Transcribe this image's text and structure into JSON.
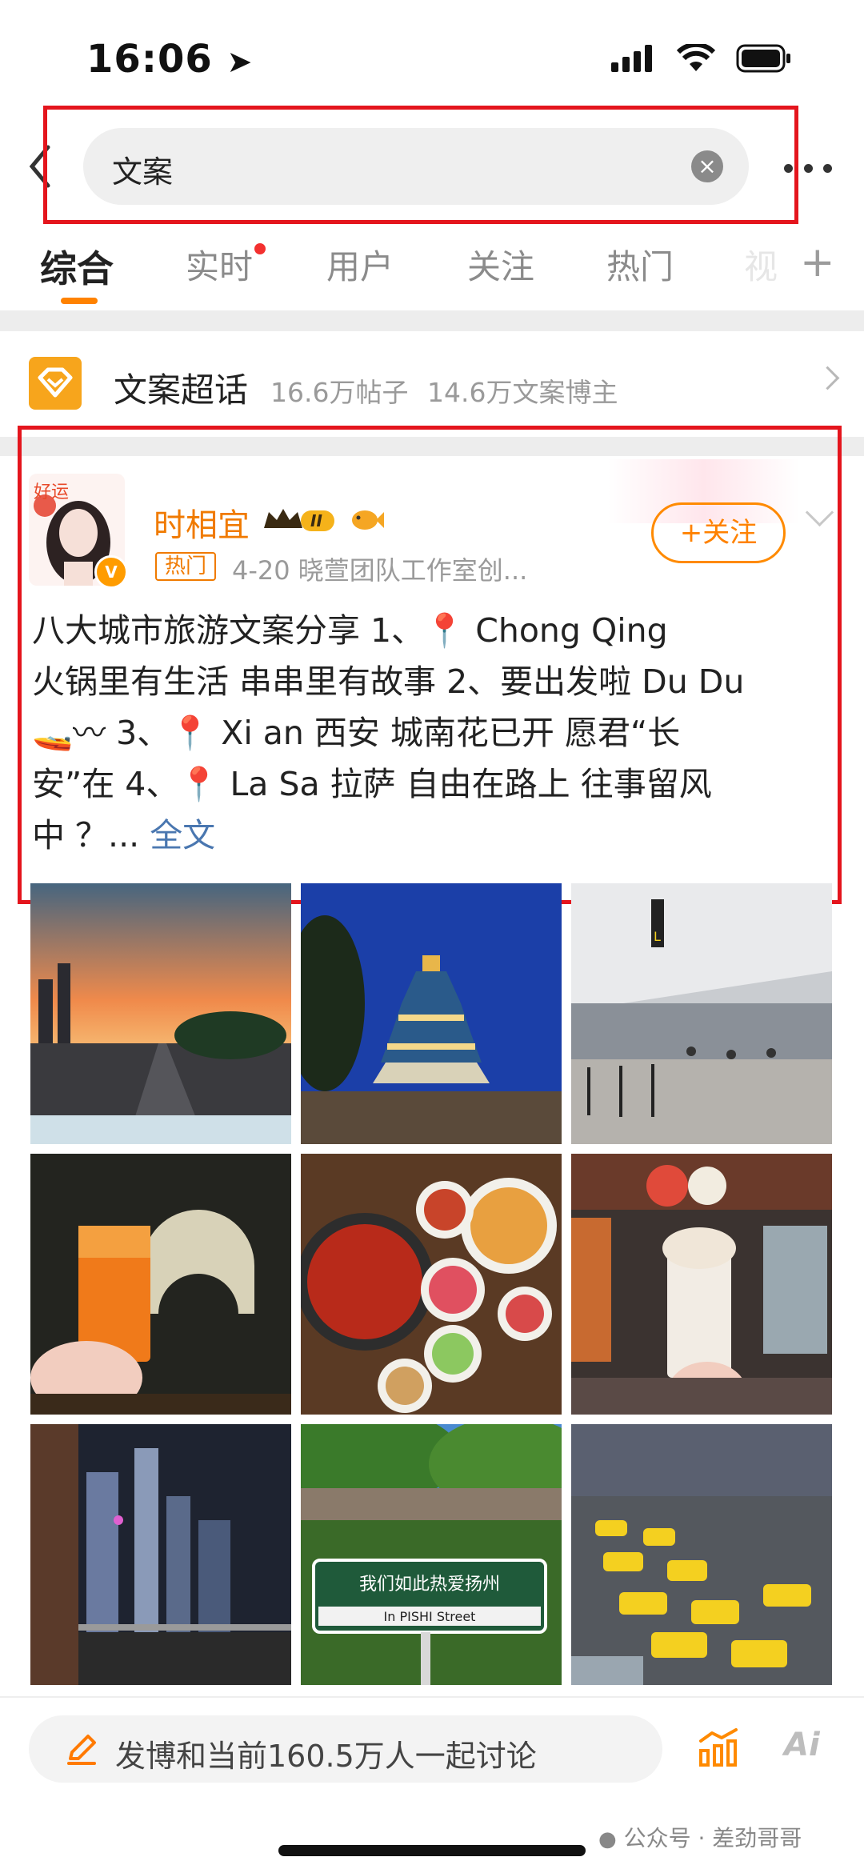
{
  "status_bar": {
    "time": "16:06"
  },
  "search": {
    "query": "文案"
  },
  "tabs": [
    {
      "label": "综合",
      "active": true
    },
    {
      "label": "实时",
      "has_dot": true
    },
    {
      "label": "用户"
    },
    {
      "label": "关注"
    },
    {
      "label": "热门"
    }
  ],
  "super_topic": {
    "name": "文案超话",
    "posts": "16.6万帖子",
    "bloggers": "14.6万文案博主"
  },
  "post": {
    "author": "时相宜",
    "hot_badge": "热门",
    "meta": "4-20  晓萱团队工作室创...",
    "follow_label": "+关注",
    "text_lines": [
      "八大城市旅游文案分享 1、📍 Chong Qing",
      "火锅里有生活 串串里有故事 2、要出发啦 Du Du",
      "🚤〰 3、📍 Xi an 西安      城南花已开 愿君“长",
      "安”在 4、📍 La Sa 拉萨      自由在路上 往事留风",
      "中 ？..."
    ],
    "full_text_link": "全文",
    "photos": [
      "sunset-highway",
      "temple-of-heaven",
      "railway-station",
      "drink-by-bridge",
      "hotpot-table",
      "milk-tea-street",
      "night-skyline",
      "yangzhou-street-sign",
      "taxi-queue"
    ],
    "street_sign_text": "我们如此热爱扬州",
    "street_sign_sub": "In PISHI Street"
  },
  "bottom_bar": {
    "compose_placeholder": "发博和当前160.5万人一起讨论",
    "ai_label": "Ai"
  },
  "watermark": "公众号 · 差劲哥哥",
  "colors": {
    "accent": "#ff8200",
    "highlight_red": "#e4151d",
    "link": "#4a77b0"
  }
}
